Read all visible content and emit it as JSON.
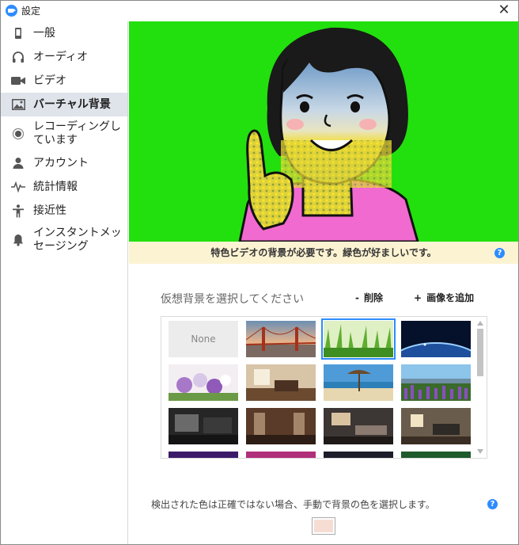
{
  "window": {
    "title": "設定"
  },
  "sidebar": {
    "items": [
      {
        "label": "一般",
        "icon": "phone-icon"
      },
      {
        "label": "オーディオ",
        "icon": "headphones-icon"
      },
      {
        "label": "ビデオ",
        "icon": "video-camera-icon"
      },
      {
        "label": "バーチャル背景",
        "icon": "image-icon",
        "active": true
      },
      {
        "label": "レコーディングしています",
        "icon": "record-icon"
      },
      {
        "label": "アカウント",
        "icon": "person-icon"
      },
      {
        "label": "統計情報",
        "icon": "pulse-icon"
      },
      {
        "label": "接近性",
        "icon": "accessibility-icon"
      },
      {
        "label": "インスタントメッセージング",
        "icon": "bell-icon"
      }
    ]
  },
  "main": {
    "notice": "特色ビデオの背景が必要です。緑色が好ましいです。",
    "section_title": "仮想背景を選択してください",
    "delete_label": "削除",
    "add_label": "画像を追加",
    "delete_glyph": "-",
    "add_glyph": "+",
    "gallery": {
      "none_label": "None",
      "selected_index": 2,
      "thumbnails": [
        "none",
        "golden-gate-bridge",
        "grass",
        "earth-from-space",
        "flowers",
        "room-interior",
        "beach",
        "lupine-field",
        "dark-room",
        "lounge",
        "living-room",
        "office-interior",
        "purple-pattern",
        "pink-pattern",
        "dark-pattern",
        "green-pattern"
      ]
    },
    "detect_text": "検出された色は正確ではない場合、手動で背景の色を選択します。",
    "help_glyph": "?",
    "chroma_color": "#f6ddd3",
    "preview_bg_color": "#22e00e"
  },
  "close_glyph": "✕"
}
